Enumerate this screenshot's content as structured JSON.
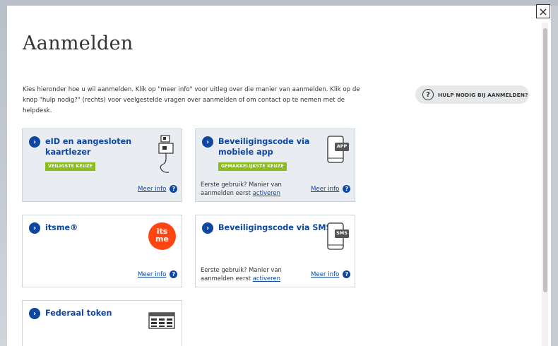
{
  "modal": {
    "close_label": "×",
    "title": "Aanmelden",
    "intro": "Kies hieronder hoe u wil aanmelden. Klik op \"meer info\" voor uitleg over die manier van aanmelden. Klik op de knop \"hulp nodig?\" (rechts) voor veelgestelde vragen over aanmelden of om contact op te nemen met de helpdesk.",
    "help_button": {
      "icon": "?",
      "label": "HULP NODIG BIJ AANMELDEN?"
    }
  },
  "options": [
    {
      "title": "eID en aangesloten kaartlezer",
      "badge": "VEILIGSTE KEUZE",
      "more_info": "Meer info",
      "icon": "card-reader-icon"
    },
    {
      "title": "Beveiligingscode via mobiele app",
      "badge": "GEMAKKELIJKSTE KEUZE",
      "first_use": "Eerste gebruik? Manier van aanmelden eerst",
      "activate": "activeren",
      "more_info": "Meer info",
      "icon": "phone-app-icon",
      "icon_text": "APP"
    },
    {
      "title": "itsme®",
      "more_info": "Meer info",
      "icon": "itsme-logo-icon",
      "icon_text": "its me"
    },
    {
      "title": "Beveiligingscode via SMS",
      "first_use": "Eerste gebruik? Manier van aanmelden eerst",
      "activate": "activeren",
      "more_info": "Meer info",
      "icon": "phone-sms-icon",
      "icon_text": "SMS"
    },
    {
      "title": "Federaal token",
      "icon": "token-card-icon"
    }
  ],
  "colors": {
    "brand_blue": "#0d47a1",
    "badge_green": "#8bbd1d",
    "itsme_orange": "#ff4612"
  }
}
